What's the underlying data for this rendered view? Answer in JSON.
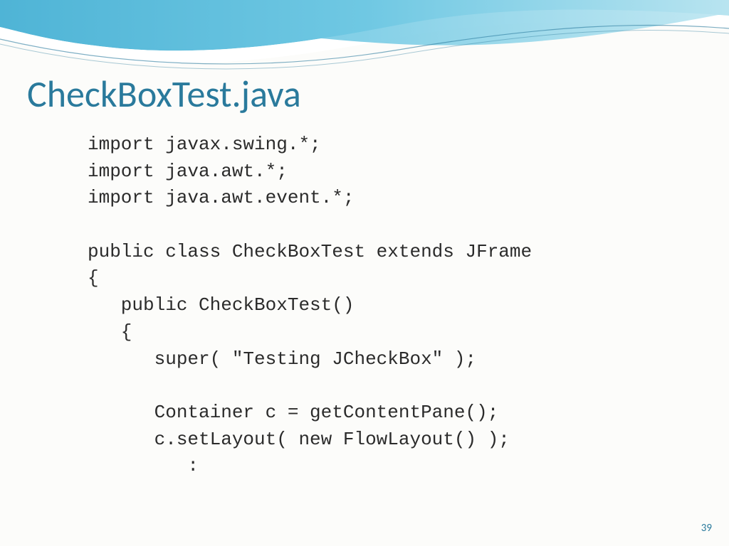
{
  "slide": {
    "title": "CheckBoxTest.java",
    "page_number": "39"
  },
  "code": {
    "line1": "import javax.swing.*;",
    "line2": "import java.awt.*;",
    "line3": "import java.awt.event.*;",
    "line4": "",
    "line5": "public class CheckBoxTest extends JFrame",
    "line6": "{",
    "line7": "   public CheckBoxTest()",
    "line8": "   {",
    "line9": "      super( \"Testing JCheckBox\" );",
    "line10": "",
    "line11": "      Container c = getContentPane();",
    "line12": "      c.setLayout( new FlowLayout() );",
    "line13": "         :"
  }
}
